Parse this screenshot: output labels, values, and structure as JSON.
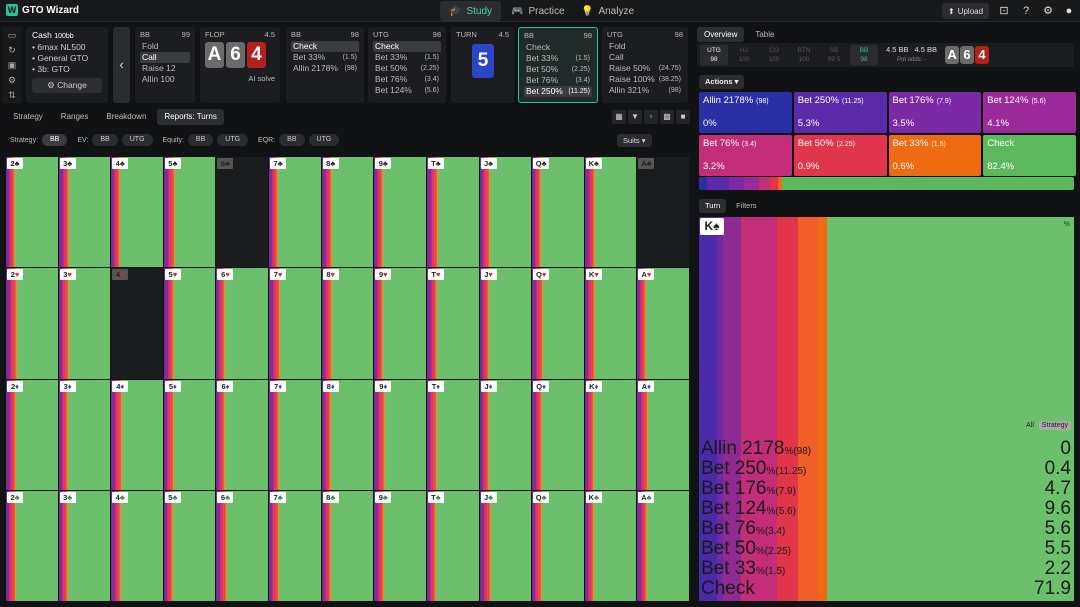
{
  "app": {
    "name": "GTO Wizard",
    "tabs": [
      "Study",
      "Practice",
      "Analyze"
    ],
    "upload": "Upload"
  },
  "rail_icons": [
    "file-icon",
    "refresh-icon",
    "save-icon",
    "settings-icon",
    "sort-icon"
  ],
  "game": {
    "title": "Cash",
    "stack": "100bb",
    "lines": [
      "6max NL500",
      "General GTO",
      "3b: GTO"
    ],
    "change": "Change"
  },
  "history": [
    {
      "pos": "BB",
      "val": "99",
      "opts": [
        [
          "Fold",
          ""
        ],
        [
          "Call",
          ""
        ],
        [
          "Raise 12",
          ""
        ],
        [
          "Allin 100",
          ""
        ]
      ],
      "sel": 1
    },
    {
      "pos": "FLOP",
      "val": "4.5",
      "board": [
        {
          "r": "A",
          "c": "#6b6b6b"
        },
        {
          "r": "6",
          "c": "#6b6b6b"
        },
        {
          "r": "4",
          "c": "#b3211f"
        }
      ],
      "solve": "AI solve"
    },
    {
      "pos": "BB",
      "val": "98",
      "opts": [
        [
          "Check",
          ""
        ],
        [
          "Bet 33%",
          "(1.5)"
        ],
        [
          "Allin 2178%",
          "(98)"
        ]
      ],
      "sel": 0
    },
    {
      "pos": "UTG",
      "val": "98",
      "opts": [
        [
          "Check",
          ""
        ],
        [
          "Bet 33%",
          "(1.5)"
        ],
        [
          "Bet 50%",
          "(2.25)"
        ],
        [
          "Bet 76%",
          "(3.4)"
        ],
        [
          "Bet 124%",
          "(5.6)"
        ]
      ],
      "sel": 0
    },
    {
      "pos": "TURN",
      "val": "4.5",
      "turn": {
        "r": "5",
        "c": "#2b45c7"
      }
    },
    {
      "pos": "BB",
      "val": "98",
      "opts": [
        [
          "Check",
          ""
        ],
        [
          "Bet 33%",
          "(1.5)"
        ],
        [
          "Bet 50%",
          "(2.25)"
        ],
        [
          "Bet 76%",
          "(3.4)"
        ],
        [
          "Bet 250%",
          "(11.25)"
        ]
      ],
      "sel": 4
    },
    {
      "pos": "UTG",
      "val": "98",
      "opts": [
        [
          "Fold",
          ""
        ],
        [
          "Call",
          ""
        ],
        [
          "Raise 50%",
          "(24.75)"
        ],
        [
          "Raise 100%",
          "(38.25)"
        ],
        [
          "Allin 321%",
          "(98)"
        ]
      ],
      "sel": -1
    }
  ],
  "subtabs": [
    "Strategy",
    "Ranges",
    "Breakdown",
    "Reports: Turns"
  ],
  "filters": {
    "strategy": "Strategy:",
    "ev": "EV:",
    "equity": "Equity:",
    "eqr": "EQR:",
    "bb": "BB",
    "utg": "UTG",
    "suits": "Suits"
  },
  "grid": {
    "ranks": [
      "2",
      "3",
      "4",
      "5",
      "6",
      "7",
      "8",
      "9",
      "T",
      "J",
      "Q",
      "K",
      "A"
    ],
    "suits": [
      {
        "s": "♣",
        "c": "#222"
      },
      {
        "s": "♥",
        "c": "#c0392b"
      },
      {
        "s": "♦",
        "c": "#2b45c7"
      },
      {
        "s": "♣",
        "c": "#2a8a3a"
      }
    ],
    "dead": [
      [
        0,
        4
      ],
      [
        0,
        12
      ],
      [
        1,
        2
      ]
    ],
    "colors": [
      "#6b2aa6",
      "#8e2a90",
      "#c42d78",
      "#e0356a",
      "#e24a4f",
      "#ef5f27",
      "#f08c2a"
    ]
  },
  "right": {
    "tabs": [
      "Overview",
      "Table"
    ],
    "positions": [
      [
        "UTG",
        "98",
        true
      ],
      [
        "HJ",
        "100",
        false
      ],
      [
        "CO",
        "100",
        false
      ],
      [
        "BTN",
        "100",
        false
      ],
      [
        "SB",
        "99.5",
        false
      ],
      [
        "BB",
        "98",
        true
      ]
    ],
    "pot": "4.5 BB",
    "pot2": "4.5 BB",
    "pot_label": "Pot odds: -",
    "board": [
      {
        "r": "A",
        "c": "#6b6b6b"
      },
      {
        "r": "6",
        "c": "#6b6b6b"
      },
      {
        "r": "4",
        "c": "#b3211f"
      }
    ],
    "actions_label": "Actions",
    "actions": [
      {
        "name": "Allin 2178%",
        "size": "(98)",
        "pct": "0%",
        "color": "#2a2fa5"
      },
      {
        "name": "Bet 250%",
        "size": "(11.25)",
        "pct": "5.3%",
        "color": "#5b2aa8"
      },
      {
        "name": "Bet 176%",
        "size": "(7.9)",
        "pct": "3.5%",
        "color": "#7a2aa5"
      },
      {
        "name": "Bet 124%",
        "size": "(5.6)",
        "pct": "4.1%",
        "color": "#9b2a9a"
      },
      {
        "name": "Bet 76%",
        "size": "(3.4)",
        "pct": "3.2%",
        "color": "#c42d78"
      },
      {
        "name": "Bet 50%",
        "size": "(2.25)",
        "pct": "0.9%",
        "color": "#e0354b"
      },
      {
        "name": "Bet 33%",
        "size": "(1.5)",
        "pct": "0.6%",
        "color": "#ef6a10"
      },
      {
        "name": "Check",
        "size": "",
        "pct": "82.4%",
        "color": "#5cb85c"
      }
    ],
    "turn_tabs": [
      "Turn",
      "Filters"
    ],
    "turn_card": {
      "r": "K",
      "s": "♠"
    },
    "toggle": [
      "All",
      "Strategy"
    ],
    "legend": [
      {
        "name": "Allin 2178",
        "size": "%(98)",
        "value": "0",
        "frac": 0
      },
      {
        "name": "Bet 250",
        "size": "%(11.25)",
        "value": "0.4",
        "frac": 0.004
      },
      {
        "name": "Bet 176",
        "size": "%(7.9)",
        "value": "4.7",
        "frac": 0.047
      },
      {
        "name": "Bet 124",
        "size": "%(5.6)",
        "value": "9.6",
        "frac": 0.096
      },
      {
        "name": "Bet 76",
        "size": "%(3.4)",
        "value": "5.6",
        "frac": 0.056
      },
      {
        "name": "Bet 50",
        "size": "%(2.25)",
        "value": "5.5",
        "frac": 0.055
      },
      {
        "name": "Bet 33",
        "size": "%(1.5)",
        "value": "2.2",
        "frac": 0.022
      },
      {
        "name": "Check",
        "size": "",
        "value": "71.9",
        "frac": 0.719
      }
    ]
  }
}
